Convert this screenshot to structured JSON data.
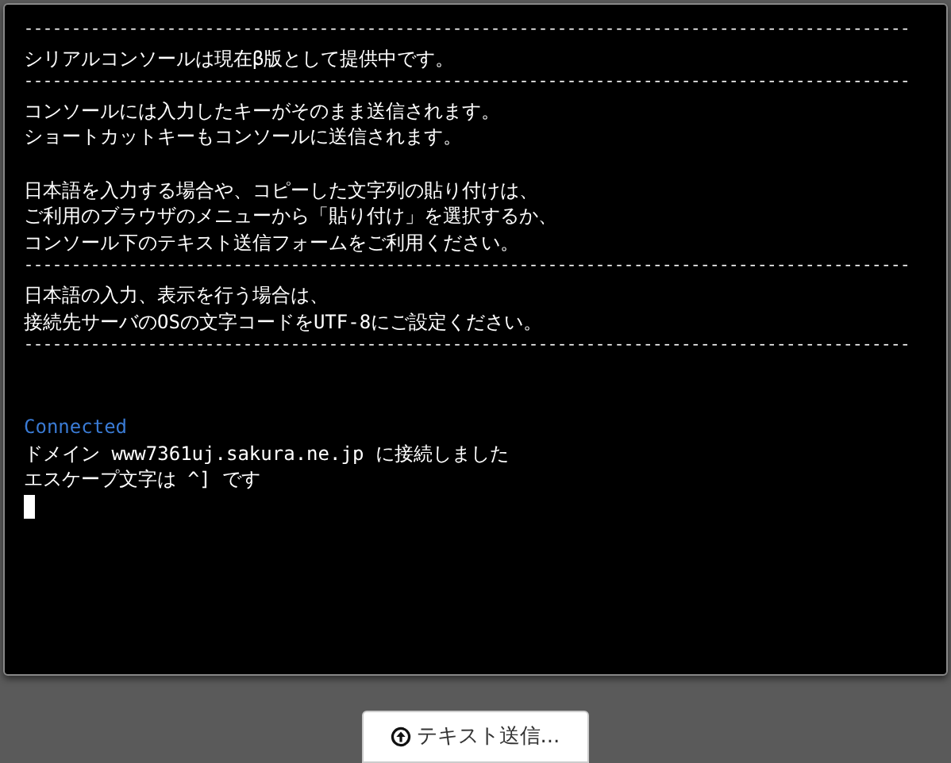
{
  "console": {
    "lines": [
      {
        "kind": "rule",
        "text": "---------------------------------------------------------------------------------------------"
      },
      {
        "kind": "text",
        "text": "シリアルコンソールは現在β版として提供中です。"
      },
      {
        "kind": "rule",
        "text": "---------------------------------------------------------------------------------------------"
      },
      {
        "kind": "text",
        "text": "コンソールには入力したキーがそのまま送信されます。"
      },
      {
        "kind": "text",
        "text": "ショートカットキーもコンソールに送信されます。"
      },
      {
        "kind": "blank"
      },
      {
        "kind": "text",
        "text": "日本語を入力する場合や、コピーした文字列の貼り付けは、"
      },
      {
        "kind": "text",
        "text": "ご利用のブラウザのメニューから「貼り付け」を選択するか、"
      },
      {
        "kind": "text",
        "text": "コンソール下のテキスト送信フォームをご利用ください。"
      },
      {
        "kind": "rule",
        "text": "---------------------------------------------------------------------------------------------"
      },
      {
        "kind": "text",
        "text": "日本語の入力、表示を行う場合は、"
      },
      {
        "kind": "text",
        "text": "接続先サーバのOSの文字コードをUTF-8にご設定ください。"
      },
      {
        "kind": "rule",
        "text": "---------------------------------------------------------------------------------------------"
      },
      {
        "kind": "blank"
      },
      {
        "kind": "blank"
      },
      {
        "kind": "status",
        "text": "Connected"
      },
      {
        "kind": "text",
        "text": "ドメイン www7361uj.sakura.ne.jp に接続しました"
      },
      {
        "kind": "text",
        "text": "エスケープ文字は ^] です"
      },
      {
        "kind": "cursor"
      }
    ]
  },
  "send_button": {
    "label": "テキスト送信..."
  }
}
